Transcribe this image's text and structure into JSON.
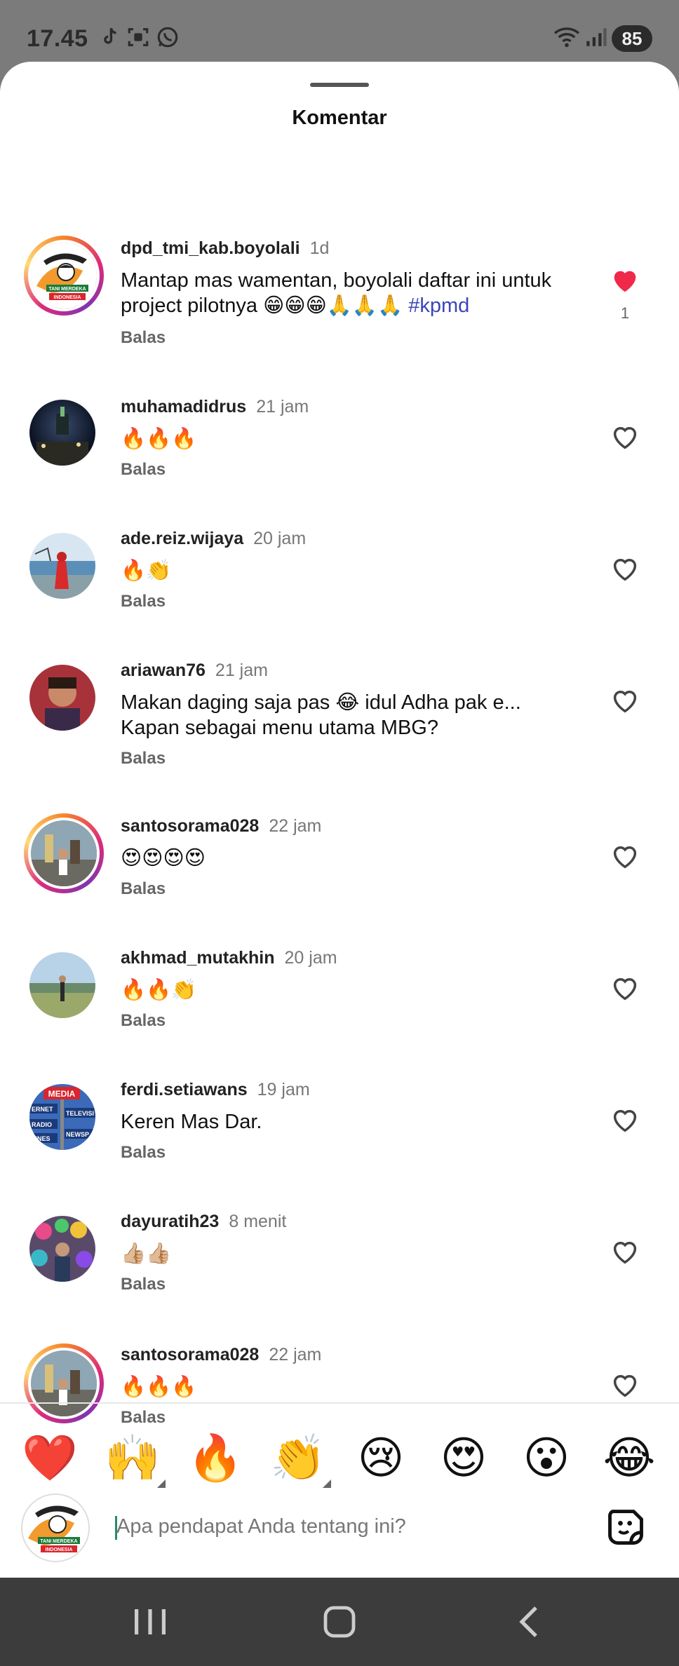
{
  "status_bar": {
    "time": "17.45",
    "battery": "85",
    "icons": [
      "tiktok-icon",
      "screenshot-icon",
      "whatsapp-icon",
      "wifi-icon",
      "signal-icon"
    ]
  },
  "sheet": {
    "title": "Komentar"
  },
  "comments": [
    {
      "username": "dpd_tmi_kab.boyolali",
      "time": "1d",
      "text": "Mantap mas wamentan, boyolali daftar ini untuk project pilotnya 😁😁😁🙏🙏🙏 ",
      "hashtag": "#kpmd",
      "reply": "Balas",
      "likes": "1",
      "liked": true,
      "ring": true,
      "avatar": "logo"
    },
    {
      "username": "muhamadidrus",
      "time": "21 jam",
      "text": "🔥🔥🔥",
      "hashtag": "",
      "reply": "Balas",
      "likes": "",
      "liked": false,
      "ring": false,
      "avatar": "night"
    },
    {
      "username": "ade.reiz.wijaya",
      "time": "20 jam",
      "text": "🔥👏",
      "hashtag": "",
      "reply": "Balas",
      "likes": "",
      "liked": false,
      "ring": false,
      "avatar": "sea"
    },
    {
      "username": "ariawan76",
      "time": "21 jam",
      "text": "Makan daging saja pas 😂 idul Adha pak e... Kapan sebagai menu utama MBG?",
      "hashtag": "",
      "reply": "Balas",
      "likes": "",
      "liked": false,
      "ring": false,
      "avatar": "portrait"
    },
    {
      "username": "santosorama028",
      "time": "22 jam",
      "text": "😍😍😍😍",
      "hashtag": "",
      "reply": "Balas",
      "likes": "",
      "liked": false,
      "ring": true,
      "avatar": "street"
    },
    {
      "username": "akhmad_mutakhin",
      "time": "20 jam",
      "text": "🔥🔥👏",
      "hashtag": "",
      "reply": "Balas",
      "likes": "",
      "liked": false,
      "ring": false,
      "avatar": "field"
    },
    {
      "username": "ferdi.setiawans",
      "time": "19 jam",
      "text": "Keren Mas Dar.",
      "hashtag": "",
      "reply": "Balas",
      "likes": "",
      "liked": false,
      "ring": false,
      "avatar": "media"
    },
    {
      "username": "dayuratih23",
      "time": "8 menit",
      "text": "👍🏼👍🏼",
      "hashtag": "",
      "reply": "Balas",
      "likes": "",
      "liked": false,
      "ring": false,
      "avatar": "colorful"
    },
    {
      "username": "santosorama028",
      "time": "22 jam",
      "text": "🔥🔥🔥",
      "hashtag": "",
      "reply": "Balas",
      "likes": "",
      "liked": false,
      "ring": true,
      "avatar": "street"
    }
  ],
  "reactions": [
    "❤️",
    "🙌",
    "🔥",
    "👏",
    "😢",
    "😍",
    "😮",
    "😂"
  ],
  "composer": {
    "placeholder": "Apa pendapat Anda tentang ini?"
  },
  "media_badge": [
    "MEDIA",
    "ERNET",
    "TELEVISI",
    "RADIO",
    "ZINES",
    "NEWSP"
  ],
  "logo_text": [
    "TANI MERDEKA",
    "INDONESIA"
  ],
  "colors": {
    "like_active": "#f0294a",
    "hashtag": "#3a46b8",
    "navbar": "#3c3c3c"
  }
}
